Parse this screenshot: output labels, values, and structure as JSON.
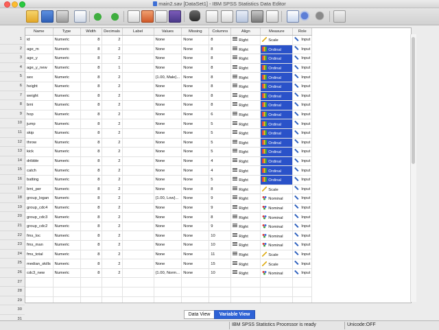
{
  "window": {
    "title": "main2.sav [DataSet1] - IBM SPSS Statistics Data Editor"
  },
  "columns": [
    "Name",
    "Type",
    "Width",
    "Decimals",
    "Label",
    "Values",
    "Missing",
    "Columns",
    "Align",
    "Measure",
    "Role"
  ],
  "rows": [
    [
      "id",
      "Numeric",
      "8",
      "2",
      "",
      "None",
      "None",
      "8",
      "Right",
      "Scale",
      "Input"
    ],
    [
      "age_m",
      "Numeric",
      "8",
      "2",
      "",
      "None",
      "None",
      "8",
      "Right",
      "Ordinal",
      "Input"
    ],
    [
      "age_y",
      "Numeric",
      "8",
      "2",
      "",
      "None",
      "None",
      "8",
      "Right",
      "Ordinal",
      "Input"
    ],
    [
      "age_y_new",
      "Numeric",
      "8",
      "1",
      "",
      "None",
      "None",
      "8",
      "Right",
      "Ordinal",
      "Input"
    ],
    [
      "sex",
      "Numeric",
      "8",
      "2",
      "",
      "{1.00, Male}...",
      "None",
      "8",
      "Right",
      "Ordinal",
      "Input"
    ],
    [
      "height",
      "Numeric",
      "8",
      "2",
      "",
      "None",
      "None",
      "8",
      "Right",
      "Ordinal",
      "Input"
    ],
    [
      "weight",
      "Numeric",
      "8",
      "2",
      "",
      "None",
      "None",
      "8",
      "Right",
      "Ordinal",
      "Input"
    ],
    [
      "bmi",
      "Numeric",
      "8",
      "2",
      "",
      "None",
      "None",
      "8",
      "Right",
      "Ordinal",
      "Input"
    ],
    [
      "hop",
      "Numeric",
      "8",
      "2",
      "",
      "None",
      "None",
      "6",
      "Right",
      "Ordinal",
      "Input"
    ],
    [
      "jump",
      "Numeric",
      "8",
      "2",
      "",
      "None",
      "None",
      "5",
      "Right",
      "Ordinal",
      "Input"
    ],
    [
      "skip",
      "Numeric",
      "8",
      "2",
      "",
      "None",
      "None",
      "5",
      "Right",
      "Ordinal",
      "Input"
    ],
    [
      "throw",
      "Numeric",
      "8",
      "2",
      "",
      "None",
      "None",
      "5",
      "Right",
      "Ordinal",
      "Input"
    ],
    [
      "kick",
      "Numeric",
      "8",
      "2",
      "",
      "None",
      "None",
      "5",
      "Right",
      "Ordinal",
      "Input"
    ],
    [
      "dribble",
      "Numeric",
      "8",
      "2",
      "",
      "None",
      "None",
      "4",
      "Right",
      "Ordinal",
      "Input"
    ],
    [
      "catch",
      "Numeric",
      "8",
      "2",
      "",
      "None",
      "None",
      "4",
      "Right",
      "Ordinal",
      "Input"
    ],
    [
      "batting",
      "Numeric",
      "8",
      "2",
      "",
      "None",
      "None",
      "5",
      "Right",
      "Ordinal",
      "Input"
    ],
    [
      "bmi_per",
      "Numeric",
      "8",
      "2",
      "",
      "None",
      "None",
      "8",
      "Right",
      "Scale",
      "Input"
    ],
    [
      "group_logan",
      "Numeric",
      "8",
      "2",
      "",
      "{1.00, Low}...",
      "None",
      "9",
      "Right",
      "Nominal",
      "Input"
    ],
    [
      "group_cdc4",
      "Numeric",
      "8",
      "2",
      "",
      "None",
      "None",
      "9",
      "Right",
      "Nominal",
      "Input"
    ],
    [
      "group_cdc3",
      "Numeric",
      "8",
      "2",
      "",
      "None",
      "None",
      "8",
      "Right",
      "Nominal",
      "Input"
    ],
    [
      "group_cdc2",
      "Numeric",
      "8",
      "2",
      "",
      "None",
      "None",
      "9",
      "Right",
      "Nominal",
      "Input"
    ],
    [
      "fms_loc",
      "Numeric",
      "8",
      "2",
      "",
      "None",
      "None",
      "10",
      "Right",
      "Nominal",
      "Input"
    ],
    [
      "fms_man",
      "Numeric",
      "8",
      "2",
      "",
      "None",
      "None",
      "10",
      "Right",
      "Nominal",
      "Input"
    ],
    [
      "fms_total",
      "Numeric",
      "8",
      "2",
      "",
      "None",
      "None",
      "11",
      "Right",
      "Scale",
      "Input"
    ],
    [
      "median_skills",
      "Numeric",
      "8",
      "2",
      "",
      "None",
      "None",
      "15",
      "Right",
      "Scale",
      "Input"
    ],
    [
      "cdc3_new",
      "Numeric",
      "8",
      "2",
      "",
      "{1.00, Norm...",
      "None",
      "10",
      "Right",
      "Nominal",
      "Input"
    ]
  ],
  "empty_row_numbers": [
    "27",
    "28",
    "29",
    "30",
    "31"
  ],
  "tabs": {
    "data_view": "Data View",
    "variable_view": "Variable View"
  },
  "status": {
    "processor": "IBM SPSS Statistics Processor is ready",
    "unicode": "Unicode:OFF"
  },
  "colors": {
    "ordinal_highlight": "#2a52c9",
    "tab_active": "#2d62d6"
  },
  "icons": [
    "open-icon",
    "save-icon",
    "print-icon",
    "recall-dialog-icon",
    "undo-icon",
    "redo-icon",
    "goto-case-icon",
    "goto-variable-icon",
    "variables-icon",
    "find-icon",
    "insert-cases-icon",
    "insert-variable-icon",
    "split-file-icon",
    "weight-cases-icon",
    "select-cases-icon",
    "value-labels-icon",
    "use-sets-icon",
    "show-all-variables-icon",
    "spell-check-icon"
  ]
}
